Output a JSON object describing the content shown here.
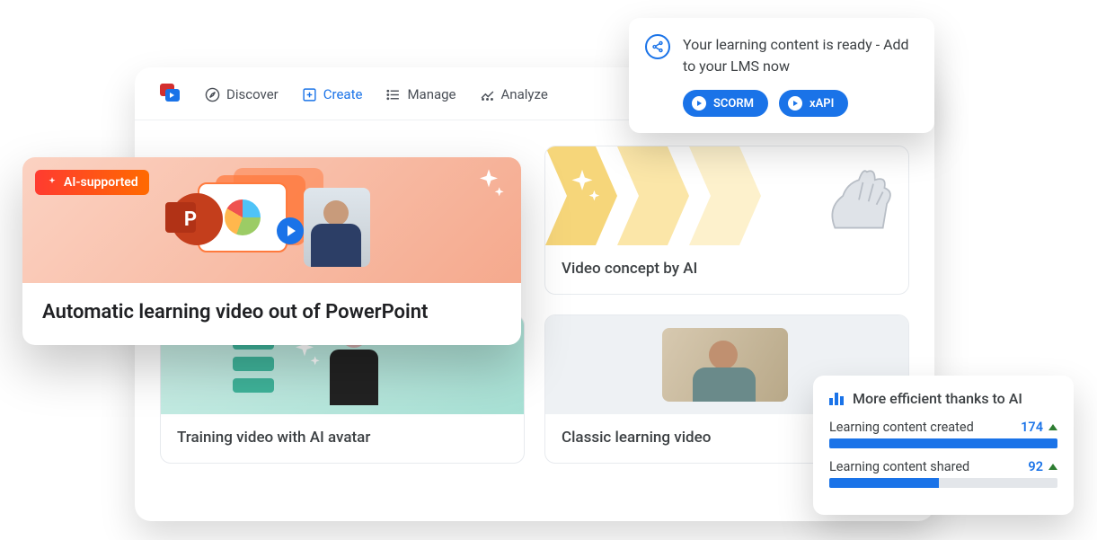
{
  "nav": {
    "discover": "Discover",
    "create": "Create",
    "manage": "Manage",
    "analyze": "Analyze"
  },
  "cards": {
    "c1_title": "Automatic learning video out of PowerPoint",
    "c1_badge": "AI-supported",
    "c2_title": "Video concept by AI",
    "c3_title": "Training video with AI avatar",
    "c4_title": "Classic learning video"
  },
  "toast": {
    "text": "Your learning content is ready - Add to your LMS now",
    "scorm": "SCORM",
    "xapi": "xAPI"
  },
  "stats": {
    "heading": "More efficient thanks to AI",
    "row1_label": "Learning content created",
    "row1_value": "174",
    "row1_pct": 100,
    "row2_label": "Learning content shared",
    "row2_value": "92",
    "row2_pct": 48
  }
}
